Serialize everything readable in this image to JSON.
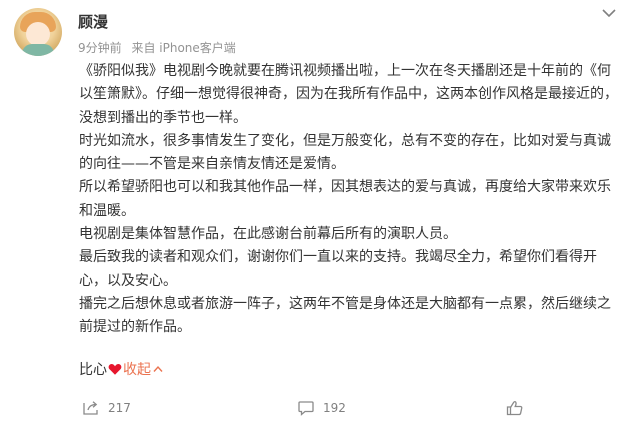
{
  "user": {
    "name": "顾漫",
    "time": "9分钟前",
    "source": "来自 iPhone客户端"
  },
  "post": {
    "paragraphs": [
      "《骄阳似我》电视剧今晚就要在腾讯视频播出啦，上一次在冬天播剧还是十年前的《何以笙箫默》。仔细一想觉得很神奇，因为在我所有作品中，这两本创作风格是最接近的，没想到播出的季节也一样。",
      "时光如流水，很多事情发生了变化，但是万般变化，总有不变的存在，比如对爱与真诚的向往——不管是来自亲情友情还是爱情。",
      "所以希望骄阳也可以和我其他作品一样，因其想表达的爱与真诚，再度给大家带来欢乐和温暖。",
      "电视剧是集体智慧作品，在此感谢台前幕后所有的演职人员。",
      "最后致我的读者和观众们，谢谢你们一直以来的支持。我竭尽全力，希望你们看得开心，以及安心。",
      "播完之后想休息或者旅游一阵子，这两年不管是身体还是大脑都有一点累，然后继续之前提过的新作品。"
    ],
    "closing": "比心",
    "collapse_label": "收起"
  },
  "actions": {
    "share_count": "217",
    "comment_count": "192",
    "like_count": ""
  },
  "colors": {
    "accent": "#eb7350",
    "heart": "#e6162d",
    "muted": "#939393"
  },
  "icons": {
    "more": "chevron-down-icon",
    "share": "share-icon",
    "comment": "comment-icon",
    "like": "thumbs-up-icon",
    "heart": "heart-icon",
    "collapse": "chevron-up-icon"
  }
}
